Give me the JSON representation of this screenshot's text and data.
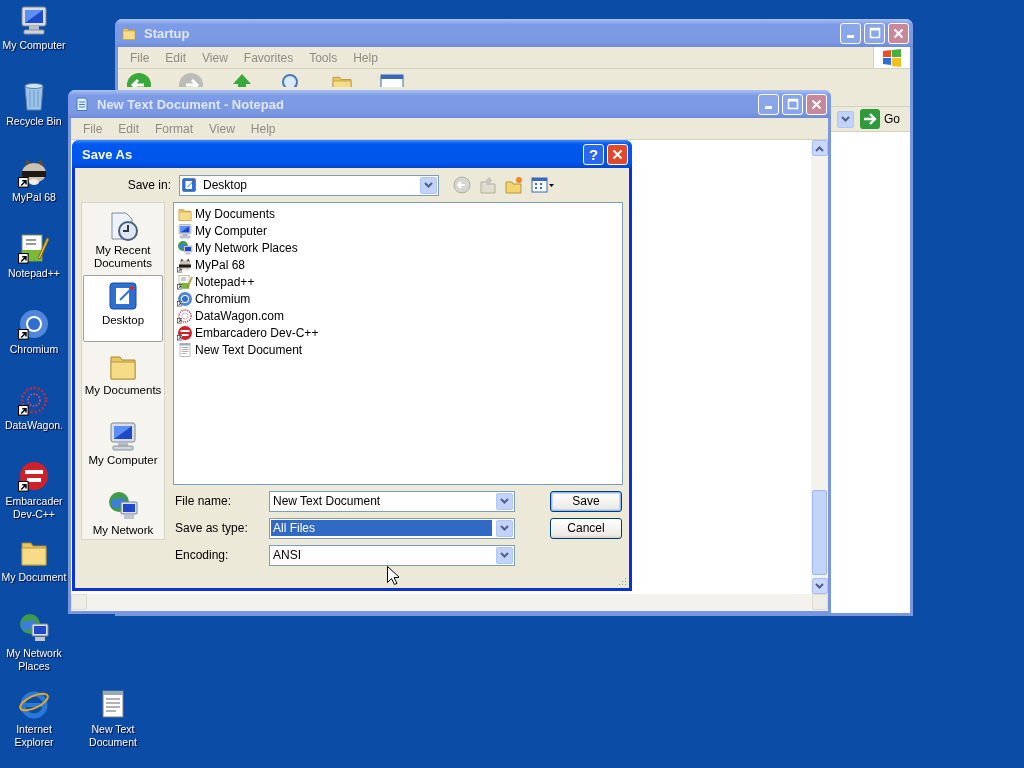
{
  "desktop_icons": [
    {
      "label": "My Computer",
      "kind": "computer",
      "shortcut": false
    },
    {
      "label": "Recycle Bin",
      "kind": "bin",
      "shortcut": false
    },
    {
      "label": "MyPal 68",
      "kind": "raccoon",
      "shortcut": true
    },
    {
      "label": "Notepad++",
      "kind": "notepadpp",
      "shortcut": true
    },
    {
      "label": "Chromium",
      "kind": "chromium",
      "shortcut": true
    },
    {
      "label": "DataWagon.",
      "kind": "datawagon",
      "shortcut": true
    },
    {
      "label": "Embarcader Dev-C++",
      "kind": "devcpp",
      "shortcut": true
    },
    {
      "label": "My Document",
      "kind": "folder",
      "shortcut": false
    },
    {
      "label": "My Network Places",
      "kind": "network",
      "shortcut": false
    },
    {
      "label": "Internet Explorer",
      "kind": "ie",
      "shortcut": false
    },
    {
      "label": "New Text Document",
      "kind": "textdoc",
      "shortcut": false
    }
  ],
  "explorer_window": {
    "title": "Startup",
    "active": false,
    "menu": [
      "File",
      "Edit",
      "View",
      "Favorites",
      "Tools",
      "Help"
    ],
    "go_button": "Go"
  },
  "notepad_window": {
    "title": "New Text Document - Notepad",
    "active": false,
    "menu": [
      "File",
      "Edit",
      "Format",
      "View",
      "Help"
    ]
  },
  "save_dialog": {
    "title": "Save As",
    "active": true,
    "help_button": "?",
    "save_in_label": "Save in:",
    "save_in_value": "Desktop",
    "places": [
      {
        "label": "My Recent Documents",
        "kind": "recent",
        "selected": false
      },
      {
        "label": "Desktop",
        "kind": "desktop",
        "selected": true
      },
      {
        "label": "My Documents",
        "kind": "folder",
        "selected": false
      },
      {
        "label": "My Computer",
        "kind": "computer",
        "selected": false
      },
      {
        "label": "My Network",
        "kind": "network",
        "selected": false
      }
    ],
    "files": [
      {
        "name": "My Documents",
        "kind": "folder",
        "shortcut": false
      },
      {
        "name": "My Computer",
        "kind": "computer",
        "shortcut": false
      },
      {
        "name": "My Network Places",
        "kind": "network",
        "shortcut": false
      },
      {
        "name": "MyPal 68",
        "kind": "raccoon",
        "shortcut": true
      },
      {
        "name": "Notepad++",
        "kind": "notepadpp",
        "shortcut": true
      },
      {
        "name": "Chromium",
        "kind": "chromium",
        "shortcut": true
      },
      {
        "name": "DataWagon.com",
        "kind": "datawagon",
        "shortcut": true
      },
      {
        "name": "Embarcadero Dev-C++",
        "kind": "devcpp",
        "shortcut": true
      },
      {
        "name": "New Text Document",
        "kind": "textdoc",
        "shortcut": false
      }
    ],
    "fields": [
      {
        "label": "File name:",
        "value": "New Text Document",
        "selected": false
      },
      {
        "label": "Save as type:",
        "value": "All Files",
        "selected": true
      },
      {
        "label": "Encoding:",
        "value": "ANSI",
        "selected": false
      }
    ],
    "buttons": [
      {
        "label": "Save",
        "default": true
      },
      {
        "label": "Cancel",
        "default": false
      }
    ]
  }
}
